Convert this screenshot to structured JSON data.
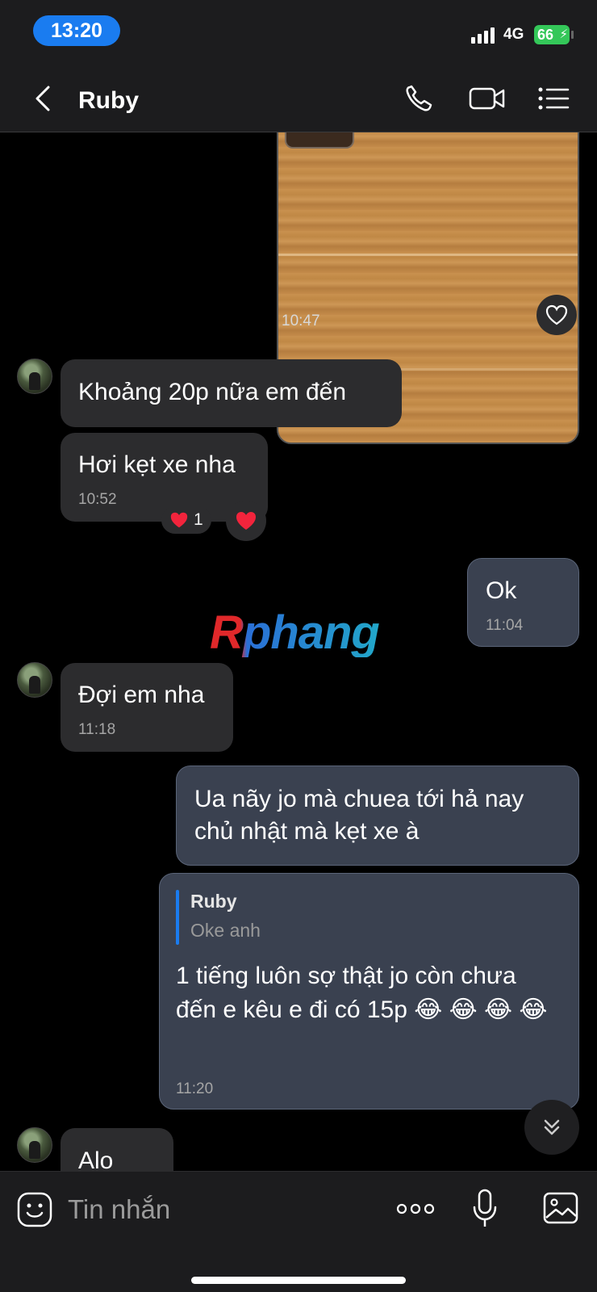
{
  "status": {
    "time": "13:20",
    "network": "4G",
    "battery": "66"
  },
  "header": {
    "title": "Ruby"
  },
  "chat": {
    "photo_time": "10:47",
    "messages": [
      {
        "text": "Khoảng 20p nữa em đến"
      },
      {
        "text": "Hơi kẹt xe nha",
        "time": "10:52",
        "reaction_count": "1"
      },
      {
        "text": "Ok",
        "time": "11:04"
      },
      {
        "text": "Đợi em nha",
        "time": "11:18"
      },
      {
        "text": "Ua nãy jo mà chuea tới hả nay chủ nhật mà kẹt xe à"
      },
      {
        "reply_name": "Ruby",
        "reply_text": "Oke anh",
        "text": "1 tiếng luôn sợ thật jo còn chưa đến e kêu e đi có 15p 😂 😂 😂 😂",
        "time": "11:20"
      },
      {
        "text": "Alo"
      }
    ],
    "watermark": "Rphang"
  },
  "input": {
    "placeholder": "Tin nhắn"
  }
}
